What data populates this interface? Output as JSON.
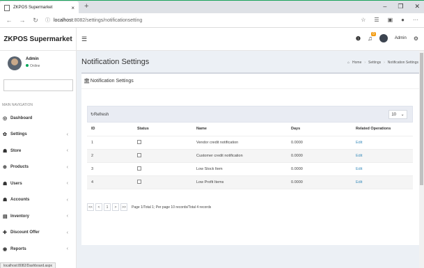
{
  "browser": {
    "tab_title": "ZKPOS Supermarket",
    "tab_close": "×",
    "new_tab": "+",
    "win_min": "–",
    "win_max": "❐",
    "win_close": "✕",
    "url_host": "localhost",
    "url_path": ":8082/settings/notificationsetting",
    "status_url": "localhost:8082/Dashboard.aspx"
  },
  "app": {
    "brand": "ZKPOS Supermarket",
    "user_name": "Admin",
    "user_status": "Online",
    "notification_count": "0",
    "header_user": "Admin"
  },
  "sidebar": {
    "header": "MAIN NAVIGATION",
    "items": [
      {
        "label": "Dashboard",
        "icon": "dashboard-icon",
        "glyph": "◎",
        "has_chevron": false
      },
      {
        "label": "Settings",
        "icon": "gear-icon",
        "glyph": "✿",
        "has_chevron": true
      },
      {
        "label": "Store",
        "icon": "people-icon",
        "glyph": "☗",
        "has_chevron": true
      },
      {
        "label": "Products",
        "icon": "products-icon",
        "glyph": "⊕",
        "has_chevron": true
      },
      {
        "label": "Users",
        "icon": "users-icon",
        "glyph": "☗",
        "has_chevron": true
      },
      {
        "label": "Accounts",
        "icon": "accounts-icon",
        "glyph": "☗",
        "has_chevron": true
      },
      {
        "label": "Inventory",
        "icon": "inventory-icon",
        "glyph": "▤",
        "has_chevron": true
      },
      {
        "label": "Discount Offer",
        "icon": "plus-icon",
        "glyph": "✚",
        "has_chevron": true
      },
      {
        "label": "Reports",
        "icon": "reports-icon",
        "glyph": "◉",
        "has_chevron": true
      }
    ]
  },
  "content": {
    "page_title": "Notification Settings",
    "breadcrumb": [
      "Home",
      "Settings",
      "Notification Settings"
    ],
    "box_title": "Notification Settings",
    "refresh_label": "Refresh",
    "page_size": "10",
    "table": {
      "headers": [
        "ID",
        "Status",
        "Name",
        "Days",
        "Related Operations"
      ],
      "rows": [
        {
          "id": "1",
          "name": "Vendor credit notification",
          "days": "0.0000",
          "op": "Edit"
        },
        {
          "id": "2",
          "name": "Customer credit notification",
          "days": "0.0000",
          "op": "Edit"
        },
        {
          "id": "3",
          "name": "Low Stock Item",
          "days": "0.0000",
          "op": "Edit"
        },
        {
          "id": "4",
          "name": "Low Profit Items",
          "days": "0.0000",
          "op": "Edit"
        }
      ]
    },
    "pager": {
      "first": "<<",
      "prev": "<",
      "page": "1",
      "next": ">",
      "last": ">>",
      "info": "Page 1/Total 1; Per page 10 records/Total 4 records"
    }
  },
  "colors": {
    "link": "#3c8dbc",
    "online": "#00a65a",
    "badge": "#f39c12",
    "grid_toolbar": "#e9ecf3"
  }
}
